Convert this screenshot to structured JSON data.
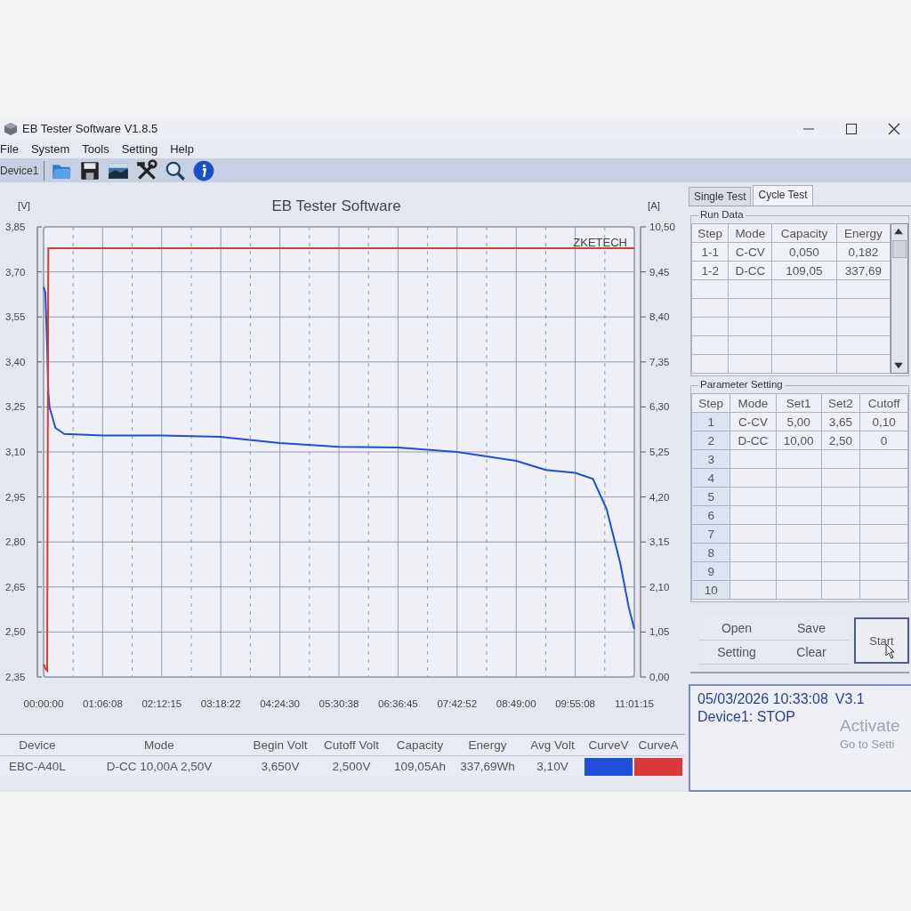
{
  "window": {
    "title": "EB Tester Software V1.8.5"
  },
  "menu": [
    "File",
    "System",
    "Tools",
    "Setting",
    "Help"
  ],
  "toolbar": {
    "device": "Device1"
  },
  "chart": {
    "logo_text": "ZKETECH",
    "chart_data": {
      "type": "line",
      "title": "EB Tester Software",
      "ylabel": "[V]",
      "y2label": "[A]",
      "grid": true,
      "x": [
        0,
        0.033,
        0.066,
        0.088,
        0.11,
        0.22,
        0.386,
        1.102,
        2.204,
        3.306,
        4.408,
        5.511,
        6.613,
        7.714,
        8.817,
        9.368,
        9.919,
        10.25,
        10.503,
        10.757,
        10.92,
        11.021
      ],
      "xlim": [
        0,
        11.021
      ],
      "ylim": [
        2.35,
        3.85
      ],
      "y2lim": [
        0,
        10.5
      ],
      "xticks": [
        {
          "value": 0,
          "label": "00:00:00"
        },
        {
          "value": 1.1022,
          "label": "01:06:08"
        },
        {
          "value": 2.2042,
          "label": "02:12:15"
        },
        {
          "value": 3.3061,
          "label": "03:18:22"
        },
        {
          "value": 4.4083,
          "label": "04:24:30"
        },
        {
          "value": 5.5106,
          "label": "05:30:38"
        },
        {
          "value": 6.6125,
          "label": "06:36:45"
        },
        {
          "value": 7.7144,
          "label": "07:42:52"
        },
        {
          "value": 8.8167,
          "label": "08:49:00"
        },
        {
          "value": 9.9189,
          "label": "09:55:08"
        },
        {
          "value": 11.0208,
          "label": "11:01:15"
        }
      ],
      "yticks": [
        {
          "value": 3.85,
          "label": "3,85"
        },
        {
          "value": 3.7,
          "label": "3,70"
        },
        {
          "value": 3.55,
          "label": "3,55"
        },
        {
          "value": 3.4,
          "label": "3,40"
        },
        {
          "value": 3.25,
          "label": "3,25"
        },
        {
          "value": 3.1,
          "label": "3,10"
        },
        {
          "value": 2.95,
          "label": "2,95"
        },
        {
          "value": 2.8,
          "label": "2,80"
        },
        {
          "value": 2.65,
          "label": "2,65"
        },
        {
          "value": 2.5,
          "label": "2,50"
        },
        {
          "value": 2.35,
          "label": "2,35"
        }
      ],
      "y2ticks": [
        {
          "value": 10.5,
          "label": "10,50"
        },
        {
          "value": 9.45,
          "label": "9,45"
        },
        {
          "value": 8.4,
          "label": "8,40"
        },
        {
          "value": 7.35,
          "label": "7,35"
        },
        {
          "value": 6.3,
          "label": "6,30"
        },
        {
          "value": 5.25,
          "label": "5,25"
        },
        {
          "value": 4.2,
          "label": "4,20"
        },
        {
          "value": 3.15,
          "label": "3,15"
        },
        {
          "value": 2.1,
          "label": "2,10"
        },
        {
          "value": 1.05,
          "label": "1,05"
        },
        {
          "value": 0,
          "label": "0,00"
        }
      ],
      "series": [
        {
          "name": "CurveV",
          "color": "#1f4fd8",
          "values": [
            3.65,
            3.63,
            3.45,
            3.3,
            3.25,
            3.18,
            3.16,
            3.155,
            3.155,
            3.15,
            3.13,
            3.117,
            3.115,
            3.1,
            3.07,
            3.04,
            3.03,
            3.01,
            2.91,
            2.73,
            2.58,
            2.51
          ]
        },
        {
          "name": "CurveA",
          "color": "#d83a3a",
          "axis": "y2",
          "values": [
            0.3,
            0.2,
            0.15,
            10.0,
            10.0,
            10.0,
            10.0,
            10.0,
            10.0,
            10.0,
            10.0,
            10.0,
            10.0,
            10.0,
            10.0,
            10.0,
            10.0,
            10.0,
            10.0,
            10.0,
            10.0,
            10.0
          ]
        }
      ]
    }
  },
  "summary": {
    "columns": [
      "Device",
      "Mode",
      "Begin Volt",
      "Cutoff Volt",
      "Capacity",
      "Energy",
      "Avg Volt"
    ],
    "row": [
      "EBC-A40L",
      "D-CC 10,00A 2,50V",
      "3,650V",
      "2,500V",
      "109,05Ah",
      "337,69Wh",
      "3,10V"
    ]
  },
  "tabs": [
    {
      "label": "Single Test",
      "selected": false
    },
    {
      "label": "Cycle Test",
      "selected": true
    }
  ],
  "run_data": {
    "title": "Run Data",
    "columns": [
      "Step",
      "Mode",
      "Capacity",
      "Energy"
    ],
    "rows": [
      [
        "1-1",
        "C-CV",
        "0,050",
        "0,182"
      ],
      [
        "1-2",
        "D-CC",
        "109,05",
        "337,69"
      ]
    ]
  },
  "parameter_setting": {
    "title": "Parameter Setting",
    "columns": [
      "Step",
      "Mode",
      "Set1",
      "Set2",
      "Cutoff"
    ],
    "rows": [
      [
        "1",
        "C-CV",
        "5,00",
        "3,65",
        "0,10"
      ],
      [
        "2",
        "D-CC",
        "10,00",
        "2,50",
        "0"
      ],
      [
        "3"
      ],
      [
        "4"
      ],
      [
        "5"
      ],
      [
        "6"
      ],
      [
        "7"
      ],
      [
        "8"
      ],
      [
        "9"
      ],
      [
        "10"
      ]
    ]
  },
  "buttons": [
    "Open",
    "Save",
    "Setting",
    "Clear"
  ],
  "start_button": "Start",
  "status": {
    "datetime": "05/03/2026 10:33:08",
    "version": "V3.1",
    "state": "Device1: STOP"
  },
  "activation_notice": {
    "title": "Activate",
    "subtitle": "Go to Setti"
  }
}
